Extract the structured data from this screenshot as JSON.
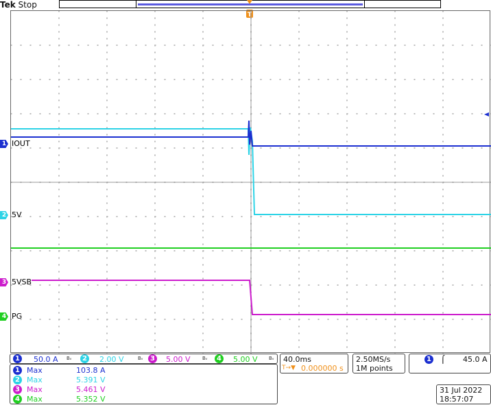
{
  "header": {
    "brand": "Tek",
    "status": "Stop"
  },
  "colors": {
    "ch1": "#1b2fd0",
    "ch2": "#2cd3e6",
    "ch3": "#cc1bcc",
    "ch4": "#1fcf20",
    "trigger": "#f0901a"
  },
  "channels": [
    {
      "num": "1",
      "label": "IOUT",
      "scale": "50.0 A",
      "bw": "Bᵥ"
    },
    {
      "num": "2",
      "label": "5V",
      "scale": "2.00 V",
      "bw": "Bᵥ"
    },
    {
      "num": "3",
      "label": "5VSB",
      "scale": "5.00 V",
      "bw": "Bᵥ"
    },
    {
      "num": "4",
      "label": "PG",
      "scale": "5.00 V",
      "bw": "Bᵥ"
    }
  ],
  "trigger_marker": "T",
  "timebase": {
    "scale": "40.0ms",
    "position": "0.000000 s",
    "position_icon": "T→▼"
  },
  "acquisition": {
    "rate": "2.50MS/s",
    "points": "1M points"
  },
  "trigger": {
    "channel": "1",
    "slope_icon": "⌠",
    "level": "45.0 A"
  },
  "measurements": [
    {
      "num": "1",
      "type": "Max",
      "value": "103.8 A"
    },
    {
      "num": "2",
      "type": "Max",
      "value": "5.391 V"
    },
    {
      "num": "3",
      "type": "Max",
      "value": "5.461 V"
    },
    {
      "num": "4",
      "type": "Max",
      "value": "5.352 V"
    }
  ],
  "datetime": {
    "date": "31 Jul  2022",
    "time": "18:57:07"
  }
}
